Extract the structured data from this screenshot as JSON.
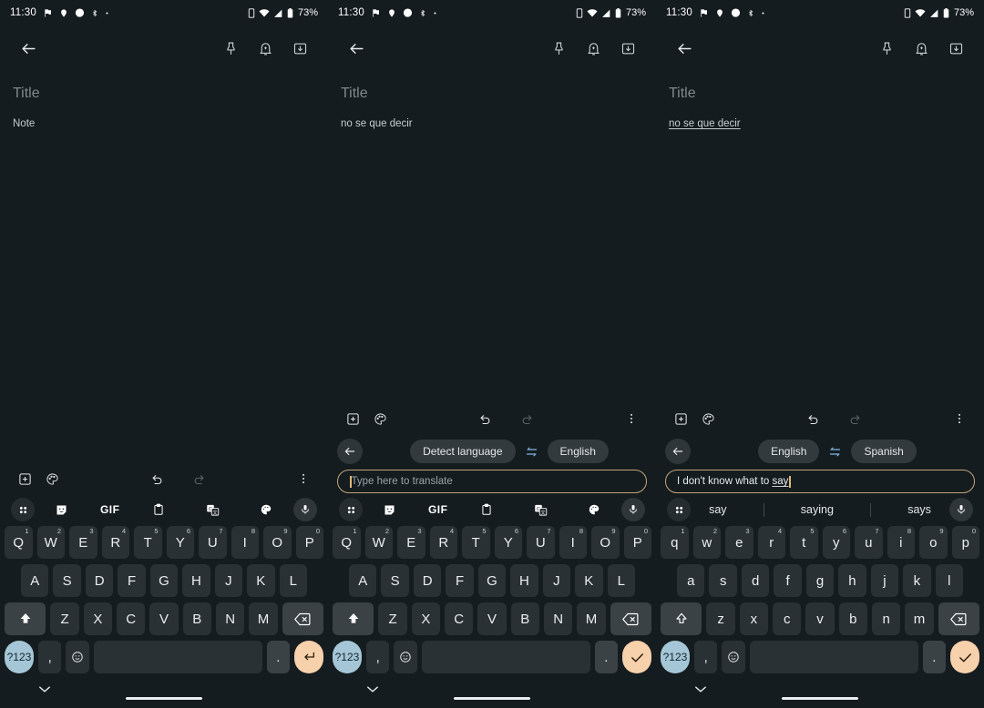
{
  "status_bar": {
    "time": "11:30",
    "battery": "73%",
    "left_icons": [
      "flag-icon",
      "location-pin-icon",
      "messenger-icon",
      "bluetooth-icon",
      "more-dot-icon"
    ],
    "right_icons": [
      "sim-card-icon",
      "wifi-icon",
      "signal-icon",
      "battery-icon"
    ]
  },
  "toolbar": {
    "back_label": "back-arrow",
    "actions": [
      "pin-icon",
      "reminder-bell-icon",
      "archive-icon"
    ]
  },
  "panels": [
    {
      "id": "panel-1",
      "note": {
        "title_placeholder": "Title",
        "body": "Note",
        "body_underlined": false
      },
      "keyboard": {
        "mode": "plain",
        "case": "upper",
        "top_actions": [
          "add-icon",
          "palette-icon",
          "undo-icon",
          "redo-icon",
          "overflow-menu-icon"
        ],
        "strip_type": "tools",
        "strip_items": [
          "grid-icon",
          "sticker-icon",
          "GIF",
          "clipboard-icon",
          "translate-icon",
          "theme-icon",
          "mic-icon"
        ],
        "rows": [
          [
            {
              "label": "Q",
              "num": "1"
            },
            {
              "label": "W",
              "num": "2"
            },
            {
              "label": "E",
              "num": "3"
            },
            {
              "label": "R",
              "num": "4"
            },
            {
              "label": "T",
              "num": "5"
            },
            {
              "label": "Y",
              "num": "6"
            },
            {
              "label": "U",
              "num": "7"
            },
            {
              "label": "I",
              "num": "8"
            },
            {
              "label": "O",
              "num": "9"
            },
            {
              "label": "P",
              "num": "0"
            }
          ],
          [
            {
              "label": "A"
            },
            {
              "label": "S"
            },
            {
              "label": "D"
            },
            {
              "label": "F"
            },
            {
              "label": "G"
            },
            {
              "label": "H"
            },
            {
              "label": "J"
            },
            {
              "label": "K"
            },
            {
              "label": "L"
            }
          ],
          [
            {
              "label": "shift-icon",
              "type": "shift"
            },
            {
              "label": "Z"
            },
            {
              "label": "X"
            },
            {
              "label": "C"
            },
            {
              "label": "V"
            },
            {
              "label": "B"
            },
            {
              "label": "N"
            },
            {
              "label": "M"
            },
            {
              "label": "backspace-icon",
              "type": "backspace"
            }
          ]
        ],
        "bottom_row": {
          "symbols": "?123",
          "comma": ",",
          "emoji": "emoji-icon",
          "space": "",
          "period": ".",
          "action": "enter-icon"
        }
      }
    },
    {
      "id": "panel-2",
      "note": {
        "title_placeholder": "Title",
        "body": "no se que decir",
        "body_underlined": false
      },
      "keyboard": {
        "mode": "translate",
        "case": "upper",
        "top_actions": [
          "add-icon",
          "palette-icon",
          "undo-icon",
          "redo-icon",
          "overflow-menu-icon"
        ],
        "translate": {
          "back": "back-arrow-icon",
          "source_lang": "Detect language",
          "swap": "swap-icon",
          "target_lang": "English",
          "input_placeholder": "Type here to translate",
          "input_value": "",
          "caret": true
        },
        "strip_type": "tools",
        "strip_items": [
          "grid-icon",
          "sticker-icon",
          "GIF",
          "clipboard-icon",
          "translate-icon",
          "theme-icon",
          "mic-icon"
        ],
        "rows": [
          [
            {
              "label": "Q",
              "num": "1"
            },
            {
              "label": "W",
              "num": "2"
            },
            {
              "label": "E",
              "num": "3"
            },
            {
              "label": "R",
              "num": "4"
            },
            {
              "label": "T",
              "num": "5"
            },
            {
              "label": "Y",
              "num": "6"
            },
            {
              "label": "U",
              "num": "7"
            },
            {
              "label": "I",
              "num": "8"
            },
            {
              "label": "O",
              "num": "9"
            },
            {
              "label": "P",
              "num": "0"
            }
          ],
          [
            {
              "label": "A"
            },
            {
              "label": "S"
            },
            {
              "label": "D"
            },
            {
              "label": "F"
            },
            {
              "label": "G"
            },
            {
              "label": "H"
            },
            {
              "label": "J"
            },
            {
              "label": "K"
            },
            {
              "label": "L"
            }
          ],
          [
            {
              "label": "shift-icon",
              "type": "shift"
            },
            {
              "label": "Z"
            },
            {
              "label": "X"
            },
            {
              "label": "C"
            },
            {
              "label": "V"
            },
            {
              "label": "B"
            },
            {
              "label": "N"
            },
            {
              "label": "M"
            },
            {
              "label": "backspace-icon",
              "type": "backspace"
            }
          ]
        ],
        "bottom_row": {
          "symbols": "?123",
          "comma": ",",
          "emoji": "emoji-icon",
          "space": "",
          "period": ".",
          "action": "check-icon"
        }
      }
    },
    {
      "id": "panel-3",
      "note": {
        "title_placeholder": "Title",
        "body": "no se que decir",
        "body_underlined": true
      },
      "keyboard": {
        "mode": "translate",
        "case": "lower",
        "top_actions": [
          "add-icon",
          "palette-icon",
          "undo-icon",
          "redo-icon",
          "overflow-menu-icon"
        ],
        "translate": {
          "back": "back-arrow-icon",
          "source_lang": "English",
          "swap": "swap-icon",
          "target_lang": "Spanish",
          "input_placeholder": "Type here to translate",
          "input_value_prefix": "I don't know what to ",
          "input_value_underlined": "say",
          "caret": true
        },
        "strip_type": "suggestions",
        "suggestions": [
          "say",
          "saying",
          "says"
        ],
        "rows": [
          [
            {
              "label": "q",
              "num": "1"
            },
            {
              "label": "w",
              "num": "2"
            },
            {
              "label": "e",
              "num": "3"
            },
            {
              "label": "r",
              "num": "4"
            },
            {
              "label": "t",
              "num": "5"
            },
            {
              "label": "y",
              "num": "6"
            },
            {
              "label": "u",
              "num": "7"
            },
            {
              "label": "i",
              "num": "8"
            },
            {
              "label": "o",
              "num": "9"
            },
            {
              "label": "p",
              "num": "0"
            }
          ],
          [
            {
              "label": "a"
            },
            {
              "label": "s"
            },
            {
              "label": "d"
            },
            {
              "label": "f"
            },
            {
              "label": "g"
            },
            {
              "label": "h"
            },
            {
              "label": "j"
            },
            {
              "label": "k"
            },
            {
              "label": "l"
            }
          ],
          [
            {
              "label": "shift-icon",
              "type": "shift"
            },
            {
              "label": "z"
            },
            {
              "label": "x"
            },
            {
              "label": "c"
            },
            {
              "label": "v"
            },
            {
              "label": "b"
            },
            {
              "label": "n"
            },
            {
              "label": "m"
            },
            {
              "label": "backspace-icon",
              "type": "backspace"
            }
          ]
        ],
        "bottom_row": {
          "symbols": "?123",
          "comma": ",",
          "emoji": "emoji-icon",
          "space": "",
          "period": ".",
          "action": "check-icon"
        }
      }
    }
  ],
  "nav_bar": {
    "chevron": "chevron-down-icon",
    "home_indicator": "home-gesture-bar"
  },
  "colors": {
    "background": "#151c1f",
    "key": "#2a3134",
    "key_modifier": "#3a4246",
    "symbols_key": "#a5c6d6",
    "action_key": "#f7d0ac",
    "accent_blue": "#7eb7e8",
    "input_border": "#c2a47a",
    "text_primary": "#e9eef0",
    "text_secondary": "#7e898d"
  }
}
